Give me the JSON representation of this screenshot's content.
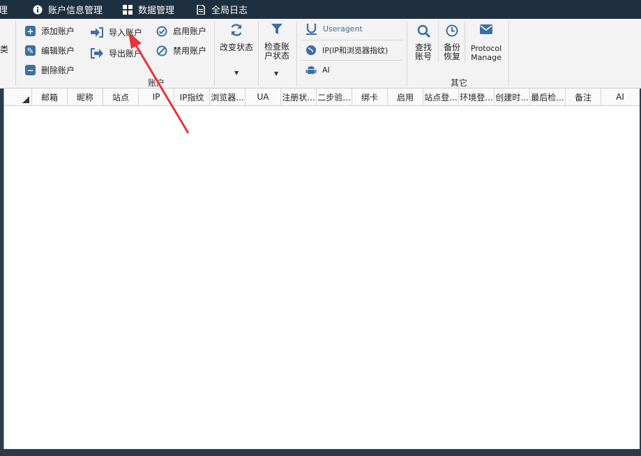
{
  "top_tabs": [
    {
      "label": "理",
      "icon": "none-icon"
    },
    {
      "label": "账户信息管理",
      "icon": "info-icon"
    },
    {
      "label": "数据管理",
      "icon": "grid-icon"
    },
    {
      "label": "全局日志",
      "icon": "document-icon"
    }
  ],
  "ribbon": {
    "left_fragment": "类",
    "account_group": {
      "label": "账户",
      "add": "添加账户",
      "edit": "编辑账户",
      "delete": "删除账户",
      "import": "导入账户",
      "export": "导出账户",
      "enable": "启用账户",
      "disable": "禁用账户",
      "change_status": "改变状态",
      "check_status": "检查账\n户状态"
    },
    "config_group": {
      "useragent": "Useragent",
      "ip": "IP(IP和浏览器指纹)",
      "ai": "AI"
    },
    "other_group": {
      "label": "其它",
      "find": "查找\n账号",
      "backup": "备份\n恢复",
      "protocol": "Protocol\nManage"
    }
  },
  "table": {
    "columns": [
      "邮箱",
      "昵称",
      "站点",
      "IP",
      "IP指纹",
      "浏览器...",
      "UA",
      "注册状...",
      "二步验...",
      "绑卡",
      "启用",
      "站点登...",
      "环境登...",
      "创建时...",
      "最后检...",
      "备注",
      "AI"
    ]
  },
  "colors": {
    "topbar": "#1e2f3f",
    "icon_blue": "#3d6fa3",
    "arrow_red": "#e8323c"
  }
}
